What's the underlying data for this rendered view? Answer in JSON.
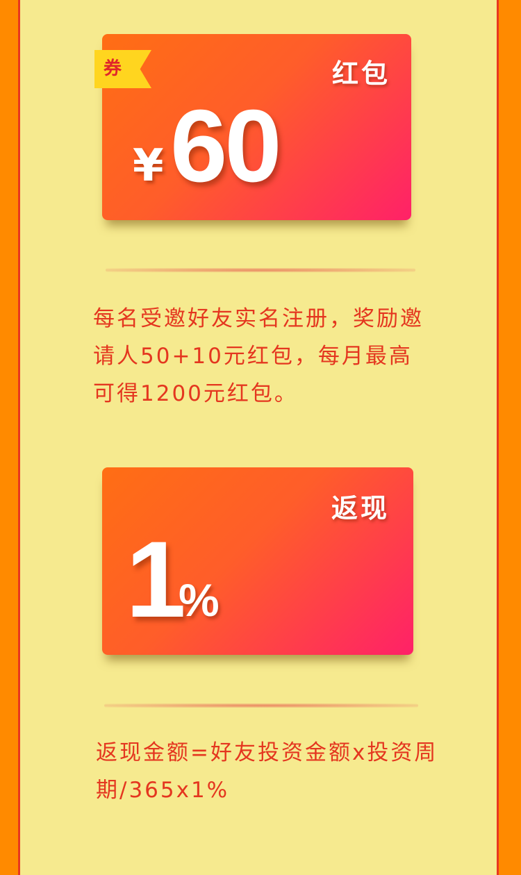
{
  "coupon": {
    "badge": "券",
    "label": "红包",
    "currency": "¥",
    "amount": "60",
    "description": "每名受邀好友实名注册，奖励邀请人50+10元红包，每月最高可得1200元红包。"
  },
  "cashback": {
    "label": "返现",
    "rate": "1",
    "unit": "%",
    "description": "返现金额=好友投资金额x投资周期/365x1%"
  },
  "colors": {
    "background": "#ff8a00",
    "panel": "#f6ea8f",
    "panel_border": "#e8381f",
    "card_gradient_start": "#ff6e14",
    "card_gradient_end": "#ff2168",
    "badge": "#ffd51f",
    "text_accent": "#e4361f"
  }
}
